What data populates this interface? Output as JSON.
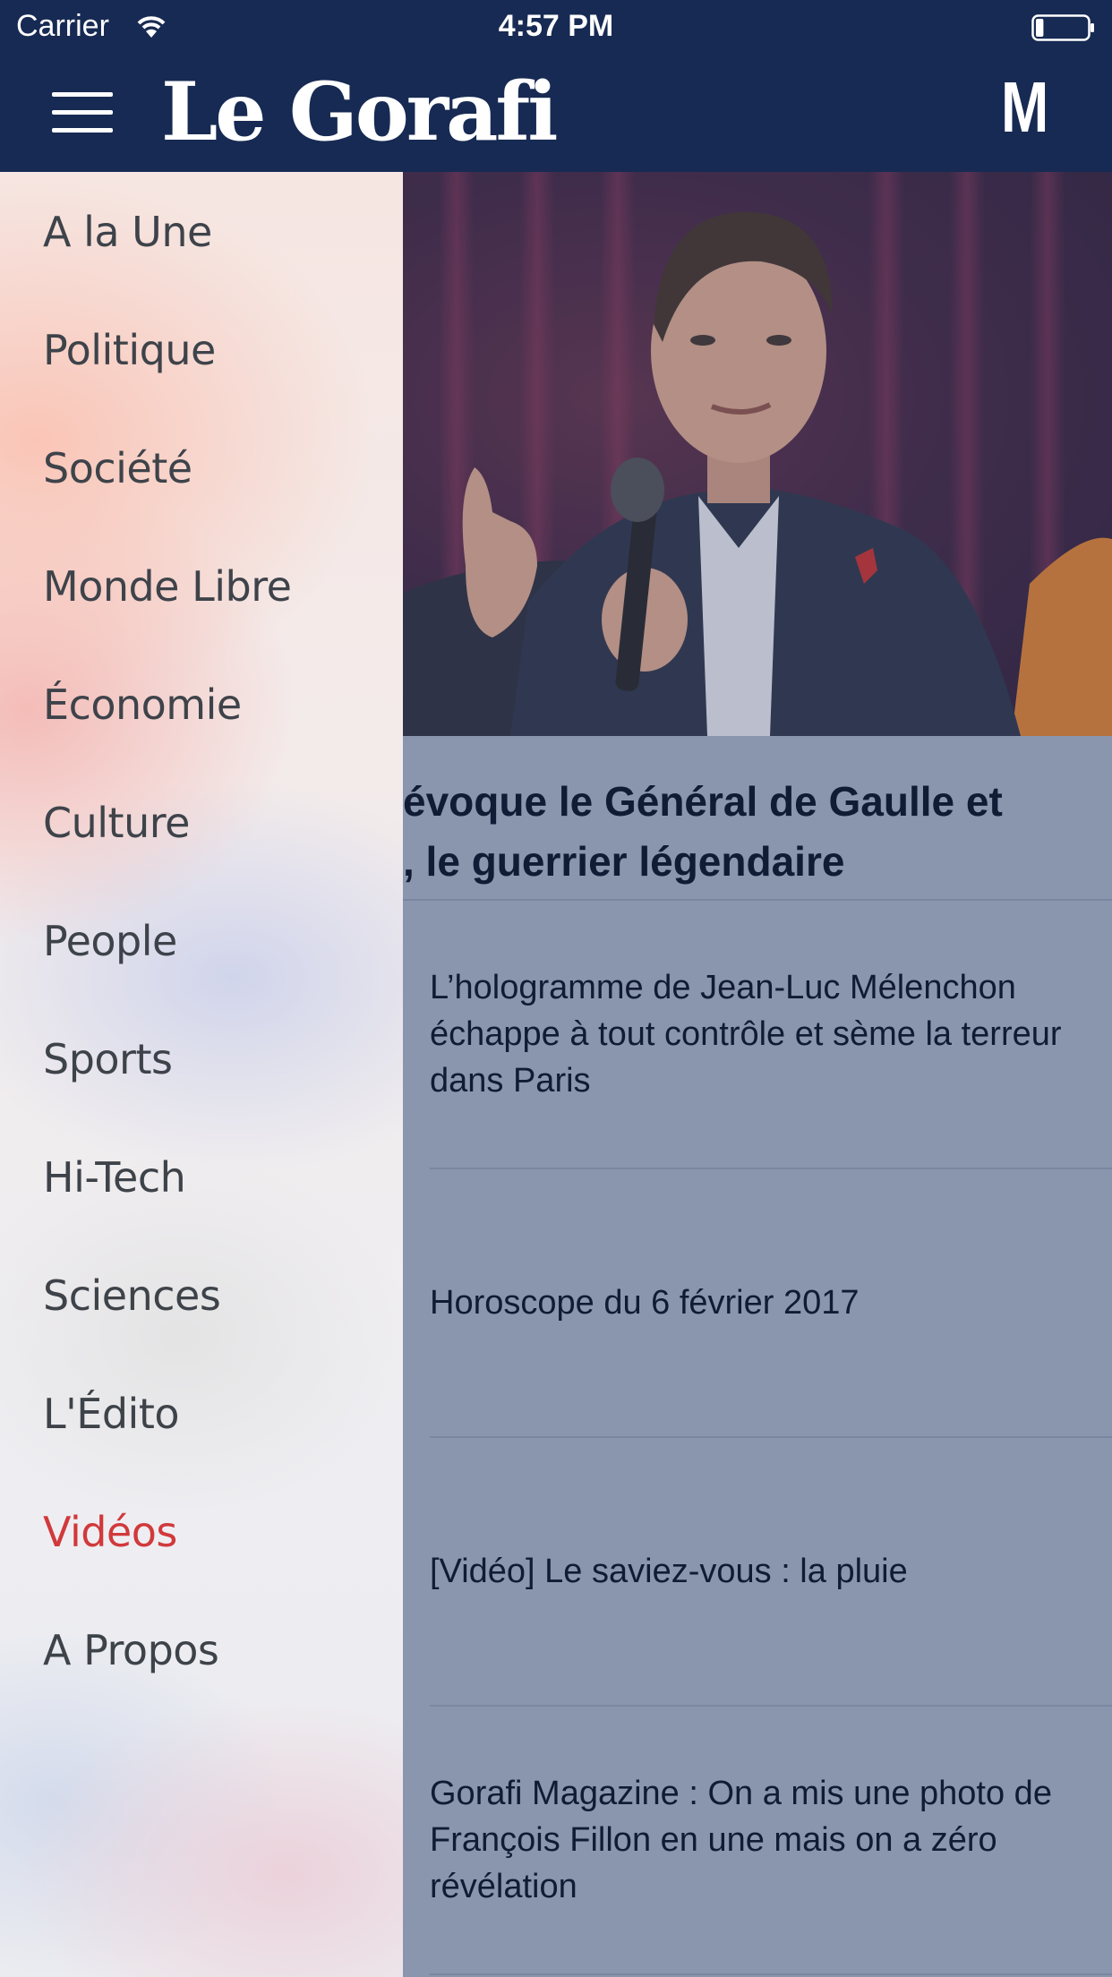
{
  "status_bar": {
    "carrier": "Carrier",
    "time": "4:57 PM",
    "battery_level": 0.15
  },
  "header": {
    "logo": "Le Gorafi",
    "right_button": "M",
    "bar_color": "#172a53"
  },
  "menu": {
    "active_color": "#d1393b",
    "items": [
      {
        "label": "A la Une"
      },
      {
        "label": "Politique"
      },
      {
        "label": "Société"
      },
      {
        "label": "Monde Libre"
      },
      {
        "label": "Économie"
      },
      {
        "label": "Culture"
      },
      {
        "label": "People"
      },
      {
        "label": "Sports"
      },
      {
        "label": "Hi-Tech"
      },
      {
        "label": "Sciences"
      },
      {
        "label": "L'Édito"
      },
      {
        "label": "Vidéos",
        "active": true
      },
      {
        "label": "A Propos"
      }
    ]
  },
  "featured": {
    "headline_line1": "évoque le Général de Gaulle et",
    "headline_line2": ", le guerrier légendaire"
  },
  "articles": [
    {
      "title": "L’hologramme de Jean-Luc Mélenchon échappe à tout contrôle et sème la terreur dans Paris"
    },
    {
      "title": "Horoscope du 6 février 2017"
    },
    {
      "title": "[Vidéo] Le saviez-vous : la pluie"
    },
    {
      "title": "Gorafi Magazine : On a mis une photo de François Fillon en une mais on a zéro révélation"
    }
  ]
}
